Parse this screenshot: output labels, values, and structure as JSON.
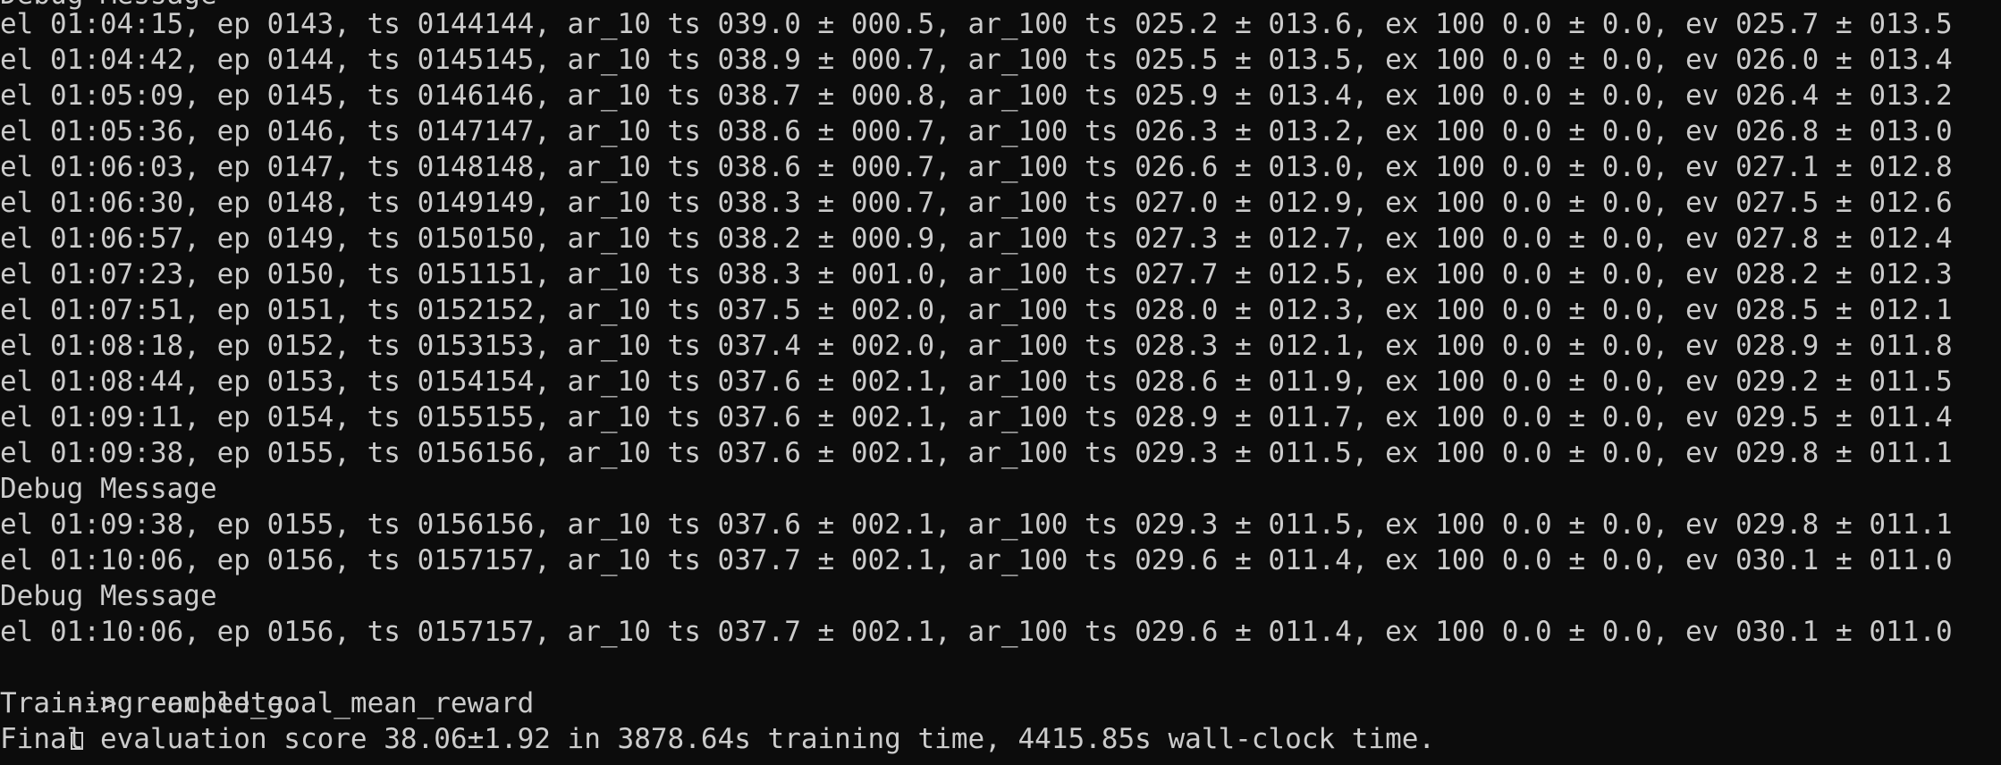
{
  "terminal": {
    "partial_line": "Debug Message",
    "lines": [
      "el 01:04:15, ep 0143, ts 0144144, ar_10 ts 039.0 ± 000.5, ar_100 ts 025.2 ± 013.6, ex 100 0.0 ± 0.0, ev 025.7 ± 013.5",
      "el 01:04:42, ep 0144, ts 0145145, ar_10 ts 038.9 ± 000.7, ar_100 ts 025.5 ± 013.5, ex 100 0.0 ± 0.0, ev 026.0 ± 013.4",
      "el 01:05:09, ep 0145, ts 0146146, ar_10 ts 038.7 ± 000.8, ar_100 ts 025.9 ± 013.4, ex 100 0.0 ± 0.0, ev 026.4 ± 013.2",
      "el 01:05:36, ep 0146, ts 0147147, ar_10 ts 038.6 ± 000.7, ar_100 ts 026.3 ± 013.2, ex 100 0.0 ± 0.0, ev 026.8 ± 013.0",
      "el 01:06:03, ep 0147, ts 0148148, ar_10 ts 038.6 ± 000.7, ar_100 ts 026.6 ± 013.0, ex 100 0.0 ± 0.0, ev 027.1 ± 012.8",
      "el 01:06:30, ep 0148, ts 0149149, ar_10 ts 038.3 ± 000.7, ar_100 ts 027.0 ± 012.9, ex 100 0.0 ± 0.0, ev 027.5 ± 012.6",
      "el 01:06:57, ep 0149, ts 0150150, ar_10 ts 038.2 ± 000.9, ar_100 ts 027.3 ± 012.7, ex 100 0.0 ± 0.0, ev 027.8 ± 012.4",
      "el 01:07:23, ep 0150, ts 0151151, ar_10 ts 038.3 ± 001.0, ar_100 ts 027.7 ± 012.5, ex 100 0.0 ± 0.0, ev 028.2 ± 012.3",
      "el 01:07:51, ep 0151, ts 0152152, ar_10 ts 037.5 ± 002.0, ar_100 ts 028.0 ± 012.3, ex 100 0.0 ± 0.0, ev 028.5 ± 012.1",
      "el 01:08:18, ep 0152, ts 0153153, ar_10 ts 037.4 ± 002.0, ar_100 ts 028.3 ± 012.1, ex 100 0.0 ± 0.0, ev 028.9 ± 011.8",
      "el 01:08:44, ep 0153, ts 0154154, ar_10 ts 037.6 ± 002.1, ar_100 ts 028.6 ± 011.9, ex 100 0.0 ± 0.0, ev 029.2 ± 011.5",
      "el 01:09:11, ep 0154, ts 0155155, ar_10 ts 037.6 ± 002.1, ar_100 ts 028.9 ± 011.7, ex 100 0.0 ± 0.0, ev 029.5 ± 011.4",
      "el 01:09:38, ep 0155, ts 0156156, ar_10 ts 037.6 ± 002.1, ar_100 ts 029.3 ± 011.5, ex 100 0.0 ± 0.0, ev 029.8 ± 011.1",
      "Debug Message",
      "el 01:09:38, ep 0155, ts 0156156, ar_10 ts 037.6 ± 002.1, ar_100 ts 029.3 ± 011.5, ex 100 0.0 ± 0.0, ev 029.8 ± 011.1",
      "el 01:10:06, ep 0156, ts 0157157, ar_10 ts 037.7 ± 002.1, ar_100 ts 029.6 ± 011.4, ex 100 0.0 ± 0.0, ev 030.1 ± 011.0",
      "Debug Message",
      "el 01:10:06, ep 0156, ts 0157157, ar_10 ts 037.7 ± 002.1, ar_100 ts 029.6 ± 011.4, ex 100 0.0 ± 0.0, ev 030.1 ± 011.0"
    ],
    "goal_line": "--> reached_goal_mean_reward",
    "goal_glyph": "missing-glyph-box-icon",
    "complete_line": "Training complete.",
    "final_line": "Final evaluation score 38.06±1.92 in 3878.64s training time, 4415.85s wall-clock time."
  },
  "colors": {
    "background": "#0c0c0c",
    "text": "#cccccc"
  }
}
